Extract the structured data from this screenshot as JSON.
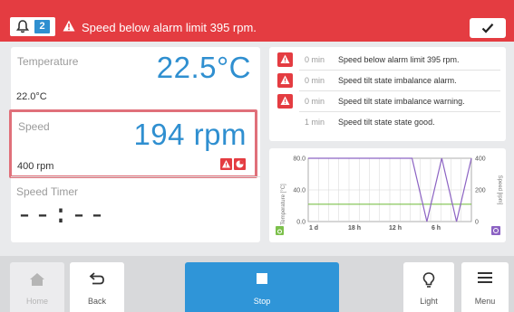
{
  "alarm": {
    "count": "2",
    "message": "Speed below alarm limit 395 rpm."
  },
  "temperature": {
    "label": "Temperature",
    "value": "22.5°C",
    "setpoint": "22.0°C"
  },
  "speed": {
    "label": "Speed",
    "value": "194 rpm",
    "setpoint": "400 rpm"
  },
  "timer": {
    "label": "Speed Timer",
    "value": "--:--"
  },
  "messages": [
    {
      "time": "0 min",
      "text": "Speed below alarm limit 395 rpm.",
      "alert": true
    },
    {
      "time": "0 min",
      "text": "Speed tilt state imbalance alarm.",
      "alert": true
    },
    {
      "time": "0 min",
      "text": "Speed tilt state imbalance warning.",
      "alert": true
    },
    {
      "time": "1 min",
      "text": "Speed tilt state state good.",
      "alert": false
    }
  ],
  "chart_data": {
    "type": "line",
    "xlabel": "",
    "x_ticks": [
      "1 d",
      "18 h",
      "12 h",
      "6 h"
    ],
    "ylabel_left": "Temperature [°C]",
    "ylabel_right": "Speed [rpm]",
    "y_left_ticks": [
      "80.0",
      "40.0",
      "0.0"
    ],
    "y_left_range": [
      0,
      80
    ],
    "y_right_ticks": [
      "400",
      "200",
      "0"
    ],
    "y_right_range": [
      0,
      400
    ],
    "series": [
      {
        "axis": "left",
        "color": "#7cc04b",
        "values": [
          22,
          22,
          22,
          22,
          22,
          22,
          22,
          22,
          22,
          22,
          22,
          22
        ]
      },
      {
        "axis": "right",
        "color": "#8c63c3",
        "values": [
          400,
          400,
          400,
          400,
          400,
          400,
          400,
          400,
          0,
          400,
          0,
          400
        ]
      }
    ]
  },
  "nav": {
    "home": "Home",
    "back": "Back",
    "stop": "Stop",
    "light": "Light",
    "menu": "Menu"
  },
  "colors": {
    "alarm_red": "#e43c41",
    "accent_blue": "#2f8fd0",
    "highlight_pink": "#e0707a"
  }
}
